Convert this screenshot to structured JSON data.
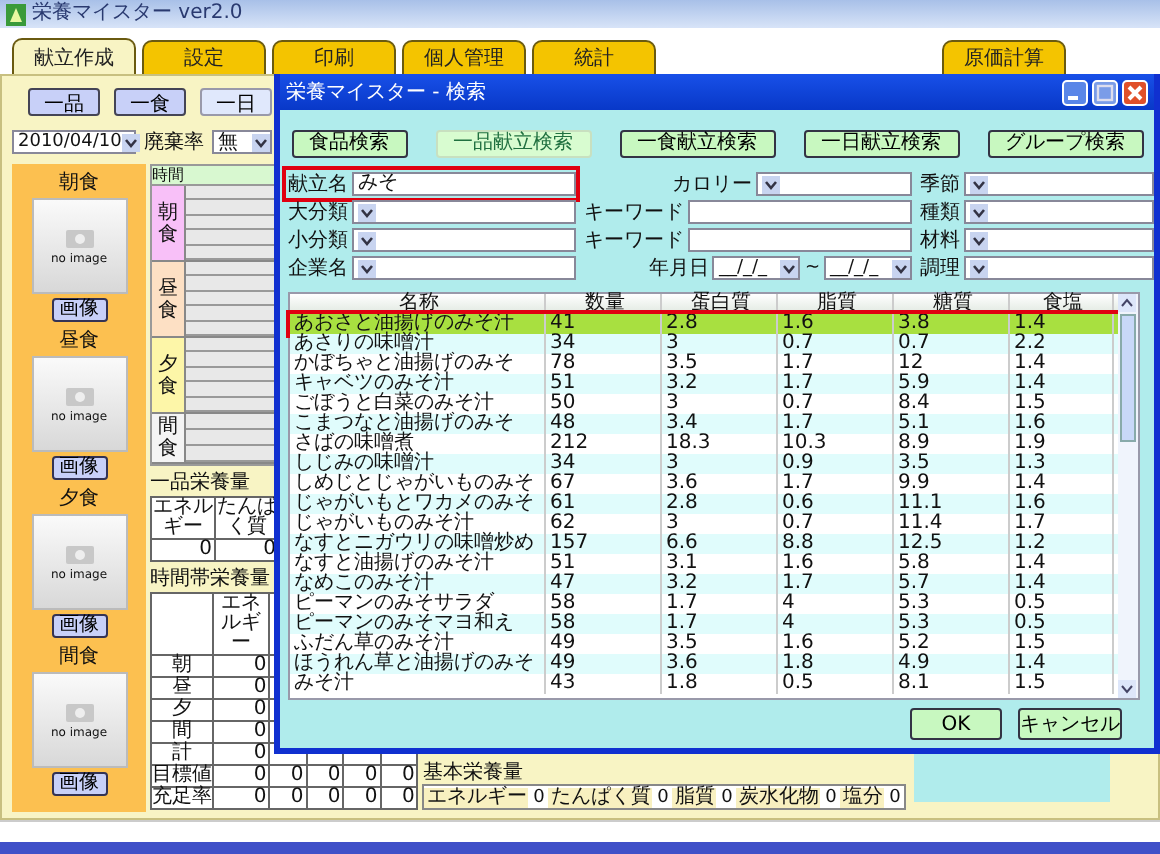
{
  "window": {
    "title": "栄養マイスター ver2.0"
  },
  "tabs": [
    {
      "label": "献立作成",
      "selected": true
    },
    {
      "label": "設定",
      "selected": false
    },
    {
      "label": "印刷",
      "selected": false
    },
    {
      "label": "個人管理",
      "selected": false
    },
    {
      "label": "統計",
      "selected": false
    },
    {
      "label": "原価計算",
      "selected": false
    }
  ],
  "mode_buttons": [
    {
      "label": "一品",
      "selected": false
    },
    {
      "label": "一食",
      "selected": false
    },
    {
      "label": "一日",
      "selected": true
    }
  ],
  "date": "2010/04/10",
  "waste": {
    "label": "廃棄率",
    "value": "無"
  },
  "meal_images": [
    {
      "label": "朝食",
      "placeholder": "no image",
      "button": "画像"
    },
    {
      "label": "昼食",
      "placeholder": "no image",
      "button": "画像"
    },
    {
      "label": "夕食",
      "placeholder": "no image",
      "button": "画像"
    },
    {
      "label": "間食",
      "placeholder": "no image",
      "button": "画像"
    }
  ],
  "time_grid": {
    "header": "時間",
    "meals": [
      {
        "label": "朝食",
        "color": "#f8c0f8"
      },
      {
        "label": "昼食",
        "color": "#fde0c4"
      },
      {
        "label": "夕食",
        "color": "#fdf6a8"
      },
      {
        "label": "間食",
        "color": "#f4f4f4"
      }
    ]
  },
  "item_nutrition": {
    "title": "一品栄養量",
    "columns": [
      "エネルギー",
      "たんぱく質"
    ],
    "values": [
      "0",
      "0"
    ]
  },
  "time_nutrition": {
    "title": "時間帯栄養量",
    "columns": [
      "エネルギー"
    ],
    "rows": [
      {
        "label": "朝",
        "values": [
          "0"
        ]
      },
      {
        "label": "昼",
        "values": [
          "0"
        ]
      },
      {
        "label": "夕",
        "values": [
          "0"
        ]
      },
      {
        "label": "間",
        "values": [
          "0"
        ]
      },
      {
        "label": "計",
        "values": [
          "0"
        ]
      },
      {
        "label": "目標値",
        "values": [
          "0",
          "0",
          "0",
          "0",
          "0"
        ]
      },
      {
        "label": "充足率",
        "values": [
          "0",
          "0",
          "0",
          "0",
          "0"
        ]
      }
    ]
  },
  "basic_nutrition": {
    "title": "基本栄養量",
    "items": [
      {
        "label": "エネルギー",
        "value": "0"
      },
      {
        "label": "たんぱく質",
        "value": "0"
      },
      {
        "label": "脂質",
        "value": "0"
      },
      {
        "label": "炭水化物",
        "value": "0"
      },
      {
        "label": "塩分",
        "value": "0"
      }
    ]
  },
  "dialog": {
    "title": "栄養マイスター - 検索",
    "search_tabs": [
      {
        "label": "食品検索",
        "selected": false
      },
      {
        "label": "一品献立検索",
        "selected": true
      },
      {
        "label": "一食献立検索",
        "selected": false
      },
      {
        "label": "一日献立検索",
        "selected": false
      },
      {
        "label": "グループ検索",
        "selected": false
      }
    ],
    "form_rows": [
      [
        {
          "label": "献立名",
          "kind": "text",
          "value": "みそ",
          "highlighted": true
        },
        {
          "label": "カロリー",
          "kind": "select"
        },
        {
          "label": "季節",
          "kind": "select"
        }
      ],
      [
        {
          "label": "大分類",
          "kind": "select"
        },
        {
          "label": "キーワード",
          "kind": "text"
        },
        {
          "label": "種類",
          "kind": "select"
        }
      ],
      [
        {
          "label": "小分類",
          "kind": "select"
        },
        {
          "label": "キーワード",
          "kind": "text"
        },
        {
          "label": "材料",
          "kind": "select"
        }
      ],
      [
        {
          "label": "企業名",
          "kind": "select"
        },
        {
          "label": "年月日",
          "kind": "date_range",
          "from": "__/_/_",
          "separator": "~",
          "to": "__/_/_"
        },
        {
          "label": "調理",
          "kind": "select"
        }
      ]
    ],
    "results": {
      "columns": [
        "名称",
        "数量",
        "蛋白質",
        "脂質",
        "糖質",
        "食塩"
      ],
      "rows": [
        {
          "cells": [
            "あおさと油揚げのみそ汁",
            "41",
            "2.8",
            "1.6",
            "3.8",
            "1.4"
          ],
          "selected": true
        },
        {
          "cells": [
            "あさりの味噌汁",
            "34",
            "3",
            "0.7",
            "0.7",
            "2.2"
          ],
          "selected": false
        },
        {
          "cells": [
            "かぼちゃと油揚げのみそ",
            "78",
            "3.5",
            "1.7",
            "12",
            "1.4"
          ],
          "selected": false
        },
        {
          "cells": [
            "キャベツのみそ汁",
            "51",
            "3.2",
            "1.7",
            "5.9",
            "1.4"
          ],
          "selected": false
        },
        {
          "cells": [
            "ごぼうと白菜のみそ汁",
            "50",
            "3",
            "0.7",
            "8.4",
            "1.5"
          ],
          "selected": false
        },
        {
          "cells": [
            "こまつなと油揚げのみそ",
            "48",
            "3.4",
            "1.7",
            "5.1",
            "1.6"
          ],
          "selected": false
        },
        {
          "cells": [
            "さばの味噌煮",
            "212",
            "18.3",
            "10.3",
            "8.9",
            "1.9"
          ],
          "selected": false
        },
        {
          "cells": [
            "しじみの味噌汁",
            "34",
            "3",
            "0.9",
            "3.5",
            "1.3"
          ],
          "selected": false
        },
        {
          "cells": [
            "しめじとじゃがいものみそ",
            "67",
            "3.6",
            "1.7",
            "9.9",
            "1.4"
          ],
          "selected": false
        },
        {
          "cells": [
            "じゃがいもとワカメのみそ",
            "61",
            "2.8",
            "0.6",
            "11.1",
            "1.6"
          ],
          "selected": false
        },
        {
          "cells": [
            "じゃがいものみそ汁",
            "62",
            "3",
            "0.7",
            "11.4",
            "1.7"
          ],
          "selected": false
        },
        {
          "cells": [
            "なすとニガウリの味噌炒め",
            "157",
            "6.6",
            "8.8",
            "12.5",
            "1.2"
          ],
          "selected": false
        },
        {
          "cells": [
            "なすと油揚げのみそ汁",
            "51",
            "3.1",
            "1.6",
            "5.8",
            "1.4"
          ],
          "selected": false
        },
        {
          "cells": [
            "なめこのみそ汁",
            "47",
            "3.2",
            "1.7",
            "5.7",
            "1.4"
          ],
          "selected": false
        },
        {
          "cells": [
            "ピーマンのみそサラダ",
            "58",
            "1.7",
            "4",
            "5.3",
            "0.5"
          ],
          "selected": false
        },
        {
          "cells": [
            "ピーマンのみそマヨ和え",
            "58",
            "1.7",
            "4",
            "5.3",
            "0.5"
          ],
          "selected": false
        },
        {
          "cells": [
            "ふだん草のみそ汁",
            "49",
            "3.5",
            "1.6",
            "5.2",
            "1.5"
          ],
          "selected": false
        },
        {
          "cells": [
            "ほうれん草と油揚げのみそ",
            "49",
            "3.6",
            "1.8",
            "4.9",
            "1.4"
          ],
          "selected": false
        },
        {
          "cells": [
            "みそ汁",
            "43",
            "1.8",
            "0.5",
            "8.1",
            "1.5"
          ],
          "selected": false
        }
      ]
    },
    "buttons": [
      "OK",
      "キャンセル"
    ]
  }
}
